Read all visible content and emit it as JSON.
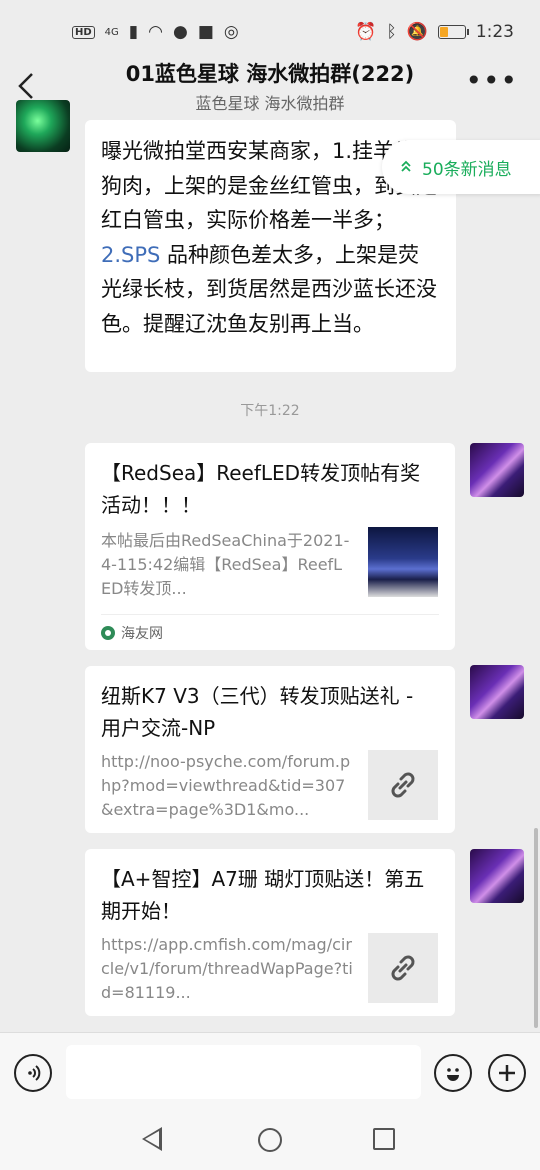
{
  "status_bar": {
    "hd": "HD",
    "network": "4G",
    "time": "1:23"
  },
  "header": {
    "title": "01蓝色星球 海水微拍群(222)",
    "subtitle": "蓝色星球 海水微拍群",
    "back_icon": "chevron-left-icon",
    "more_icon": "more-dots-icon",
    "more_label": "•••"
  },
  "new_messages": {
    "label": "50条新消息",
    "icon": "double-chevron-up-icon"
  },
  "messages": {
    "text1": {
      "part1": "曝光微拍堂西安某商家，1.挂羊头卖狗肉，上架的是金丝红管虫，到货是红白管虫，实际价格差一半多；",
      "part2": "2.SPS",
      "part3": " 品种颜色差太多，上架是荧光绿长枝，到货居然是西沙蓝长还没色。提醒辽沈鱼友别再上当。"
    },
    "time": "下午1:22",
    "card1": {
      "title": "【RedSea】ReefLED转发顶帖有奖活动！！！",
      "desc": "本帖最后由RedSeaChina于2021-4-115:42编辑【RedSea】ReefLED转发顶...",
      "source": "海友网"
    },
    "card2": {
      "title": "纽斯K7 V3（三代）转发顶贴送礼 - 用户交流-NP",
      "desc": "http://noo-psyche.com/forum.php?mod=viewthread&tid=307&extra=page%3D1&mo..."
    },
    "card3": {
      "title": "【A+智控】A7珊 瑚灯顶贴送！第五期开始！",
      "desc": "https://app.cmfish.com/mag/circle/v1/forum/threadWapPage?tid=81119..."
    }
  },
  "input_bar": {
    "voice_icon": "voice-icon",
    "emoji_icon": "emoji-icon",
    "plus_icon": "plus-icon"
  },
  "colors": {
    "accent_green": "#1aad5b",
    "link_blue": "#3f6db8",
    "background": "#ededed"
  }
}
